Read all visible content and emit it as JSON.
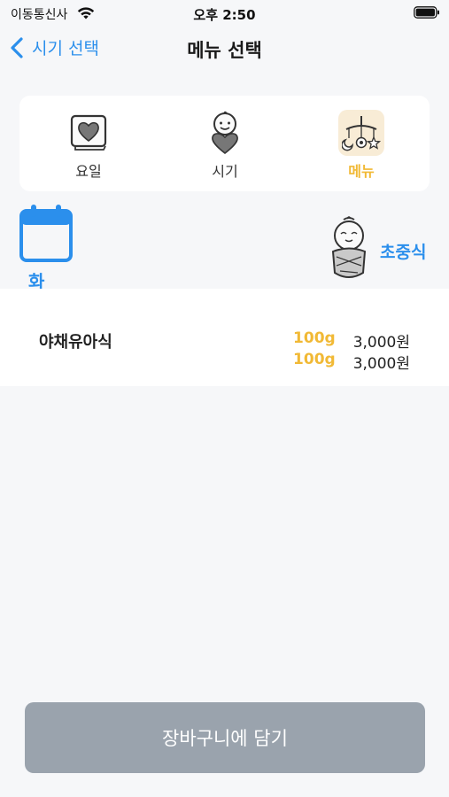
{
  "status_bar": {
    "carrier": "이동통신사",
    "time": "오후 2:50"
  },
  "nav": {
    "back_label": "시기 선택",
    "title": "메뉴 선택"
  },
  "tabs": [
    {
      "label": "요일",
      "icon": "heart-card-icon",
      "active": false
    },
    {
      "label": "시기",
      "icon": "baby-holding-heart-icon",
      "active": false
    },
    {
      "label": "메뉴",
      "icon": "baby-mobile-icon",
      "active": true
    }
  ],
  "summary": {
    "day": "화",
    "stage": "초중식"
  },
  "menu_item": {
    "name": "야채유아식",
    "options": [
      {
        "weight": "100g",
        "price": "3,000원"
      },
      {
        "weight": "100g",
        "price": "3,000원"
      }
    ]
  },
  "cart_button": {
    "label": "장바구니에 담기"
  },
  "colors": {
    "accent_blue": "#2b8fec",
    "accent_yellow": "#f1b935",
    "button_disabled": "#9aa3ad",
    "background": "#f6f7f9"
  }
}
